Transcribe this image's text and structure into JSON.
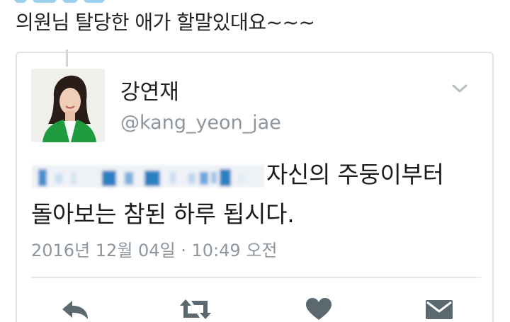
{
  "comment": {
    "text": "의원님 탈당한 애가 할말있대요~~~"
  },
  "tweet": {
    "display_name": "강연재",
    "handle": "@kang_yeon_jae",
    "body_line1": "자신의 주둥이부터",
    "body_line2": "돌아보는 참된 하루 됩시다.",
    "timestamp": "2016년 12월 04일 · 10:49 오전",
    "icons": [
      "chevron-down-icon",
      "reply-icon",
      "retweet-icon",
      "heart-icon",
      "envelope-icon"
    ]
  },
  "colors": {
    "secondary_text": "#8d969c",
    "icon_gray": "#5b6870",
    "card_border": "#dfe3e6",
    "redaction_blue": "#2b7fc2"
  }
}
